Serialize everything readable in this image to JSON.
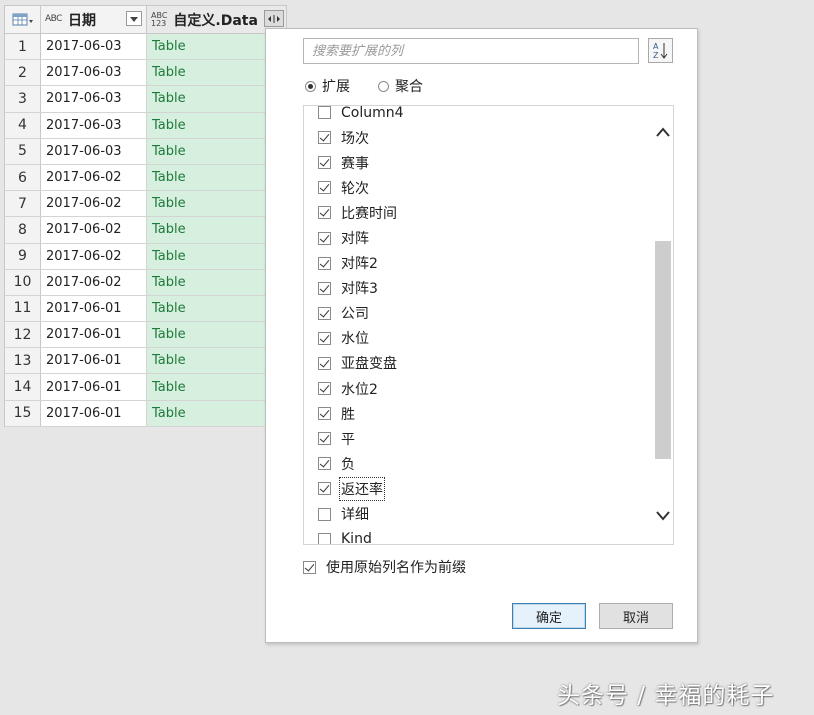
{
  "grid": {
    "columns": [
      {
        "type": "ABC",
        "title": "日期"
      },
      {
        "type": "ABC\n123",
        "title": "自定义.Data"
      }
    ],
    "rows": [
      {
        "num": "1",
        "date": "2017-06-03",
        "data": "Table"
      },
      {
        "num": "2",
        "date": "2017-06-03",
        "data": "Table"
      },
      {
        "num": "3",
        "date": "2017-06-03",
        "data": "Table"
      },
      {
        "num": "4",
        "date": "2017-06-03",
        "data": "Table"
      },
      {
        "num": "5",
        "date": "2017-06-03",
        "data": "Table"
      },
      {
        "num": "6",
        "date": "2017-06-02",
        "data": "Table"
      },
      {
        "num": "7",
        "date": "2017-06-02",
        "data": "Table"
      },
      {
        "num": "8",
        "date": "2017-06-02",
        "data": "Table"
      },
      {
        "num": "9",
        "date": "2017-06-02",
        "data": "Table"
      },
      {
        "num": "10",
        "date": "2017-06-02",
        "data": "Table"
      },
      {
        "num": "11",
        "date": "2017-06-01",
        "data": "Table"
      },
      {
        "num": "12",
        "date": "2017-06-01",
        "data": "Table"
      },
      {
        "num": "13",
        "date": "2017-06-01",
        "data": "Table"
      },
      {
        "num": "14",
        "date": "2017-06-01",
        "data": "Table"
      },
      {
        "num": "15",
        "date": "2017-06-01",
        "data": "Table"
      }
    ]
  },
  "popup": {
    "search_placeholder": "搜索要扩展的列",
    "radios": [
      {
        "label": "扩展",
        "selected": true
      },
      {
        "label": "聚合",
        "selected": false
      }
    ],
    "columns": [
      {
        "label": "Column4",
        "checked": false
      },
      {
        "label": "场次",
        "checked": true
      },
      {
        "label": "赛事",
        "checked": true
      },
      {
        "label": "轮次",
        "checked": true
      },
      {
        "label": "比赛时间",
        "checked": true
      },
      {
        "label": "对阵",
        "checked": true
      },
      {
        "label": "对阵2",
        "checked": true
      },
      {
        "label": "对阵3",
        "checked": true
      },
      {
        "label": "公司",
        "checked": true
      },
      {
        "label": "水位",
        "checked": true
      },
      {
        "label": "亚盘变盘",
        "checked": true
      },
      {
        "label": "水位2",
        "checked": true
      },
      {
        "label": "胜",
        "checked": true
      },
      {
        "label": "平",
        "checked": true
      },
      {
        "label": "负",
        "checked": true
      },
      {
        "label": "返还率",
        "checked": true,
        "focused": true
      },
      {
        "label": "详细",
        "checked": false
      },
      {
        "label": "Kind",
        "checked": false
      }
    ],
    "prefix_label": "使用原始列名作为前缀",
    "prefix_checked": true,
    "ok_label": "确定",
    "cancel_label": "取消"
  },
  "watermark": "头条号 / 幸福的耗子",
  "colors": {
    "table_cell_bg": "#d6efdf",
    "table_cell_text": "#1e7a3a",
    "ok_border": "#3c7fb1"
  }
}
